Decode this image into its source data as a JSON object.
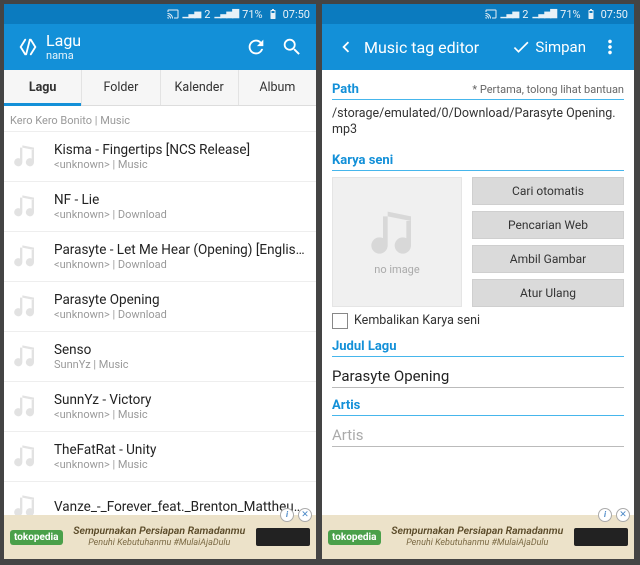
{
  "status": {
    "net2": "2",
    "battery": "71%",
    "time": "07:50"
  },
  "left": {
    "appbar": {
      "title": "Lagu",
      "subtitle": "nama"
    },
    "tabs": [
      "Lagu",
      "Folder",
      "Kalender",
      "Album"
    ],
    "active_tab": 0,
    "songs": [
      {
        "title": "",
        "sub": "Kero Kero Bonito | Music",
        "clip": true
      },
      {
        "title": "Kisma - Fingertips [NCS Release]",
        "sub": "<unknown> | Music"
      },
      {
        "title": "NF - Lie",
        "sub": "<unknown> | Download"
      },
      {
        "title": "Parasyte - Let Me Hear (Opening) [English...",
        "sub": "<unknown> | Download"
      },
      {
        "title": "Parasyte Opening",
        "sub": "<unknown> | Download"
      },
      {
        "title": "Senso",
        "sub": "SunnYz | Music"
      },
      {
        "title": "SunnYz - Victory",
        "sub": "<unknown> | Music"
      },
      {
        "title": "TheFatRat - Unity",
        "sub": "<unknown> | Music"
      },
      {
        "title": "Vanze_-_Forever_feat._Brenton_Mattheus_...",
        "sub": ""
      }
    ]
  },
  "right": {
    "appbar": {
      "title": "Music tag editor",
      "save": "Simpan"
    },
    "path_label": "Path",
    "path_help": "* Pertama, tolong lihat bantuan",
    "path_value": "/storage/emulated/0/Download/Parasyte Opening.mp3",
    "art_label": "Karya seni",
    "no_image": "no image",
    "buttons": {
      "auto": "Cari otomatis",
      "web": "Pencarian Web",
      "pick": "Ambil Gambar",
      "reset": "Atur Ulang"
    },
    "restore": "Kembalikan Karya seni",
    "title_label": "Judul Lagu",
    "title_value": "Parasyte Opening",
    "artist_label": "Artis",
    "artist_placeholder": "Artis"
  },
  "ad": {
    "brand": "tokopedia",
    "line1": "Sempurnakan Persiapan Ramadanmu",
    "line2": "Penuhi Kebutuhanmu #MulaiAjaDulu"
  }
}
